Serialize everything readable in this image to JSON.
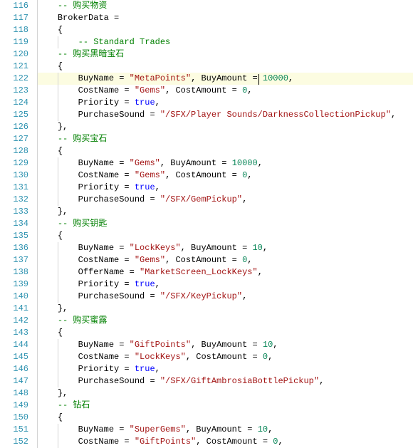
{
  "chart_data": null,
  "gutter": {
    "start": 116,
    "end": 152
  },
  "marked_line": 122,
  "lines": {
    "116": {
      "segments": [
        {
          "cls": "ind",
          "text": "    "
        },
        {
          "cls": "t-comment",
          "text": "-- 购买物资"
        }
      ]
    },
    "117": {
      "segments": [
        {
          "cls": "ind",
          "text": "    "
        },
        {
          "cls": "t-default",
          "text": "BrokerData ="
        }
      ]
    },
    "118": {
      "segments": [
        {
          "cls": "ind",
          "text": "    "
        },
        {
          "cls": "t-default",
          "text": "{"
        }
      ]
    },
    "119": {
      "segments": [
        {
          "cls": "ind",
          "text": "        "
        },
        {
          "cls": "t-comment",
          "text": "-- Standard Trades"
        }
      ]
    },
    "120": {
      "segments": [
        {
          "cls": "ind",
          "text": "    "
        },
        {
          "cls": "t-comment",
          "text": "-- 购买黑暗宝石"
        }
      ]
    },
    "121": {
      "segments": [
        {
          "cls": "ind",
          "text": "    "
        },
        {
          "cls": "t-default",
          "text": "{"
        }
      ]
    },
    "122": {
      "segments": [
        {
          "cls": "ind",
          "text": "        "
        },
        {
          "cls": "t-default",
          "text": "BuyName = "
        },
        {
          "cls": "t-string",
          "text": "\"MetaPoints\""
        },
        {
          "cls": "t-default",
          "text": ", BuyAmount ="
        },
        {
          "cls": "caret",
          "text": ""
        },
        {
          "cls": "t-default",
          "text": " "
        },
        {
          "cls": "t-number",
          "text": "10000"
        },
        {
          "cls": "t-default",
          "text": ","
        }
      ]
    },
    "123": {
      "segments": [
        {
          "cls": "ind",
          "text": "        "
        },
        {
          "cls": "t-default",
          "text": "CostName = "
        },
        {
          "cls": "t-string",
          "text": "\"Gems\""
        },
        {
          "cls": "t-default",
          "text": ", CostAmount = "
        },
        {
          "cls": "t-number",
          "text": "0"
        },
        {
          "cls": "t-default",
          "text": ","
        }
      ]
    },
    "124": {
      "segments": [
        {
          "cls": "ind",
          "text": "        "
        },
        {
          "cls": "t-default",
          "text": "Priority = "
        },
        {
          "cls": "t-keyword",
          "text": "true"
        },
        {
          "cls": "t-default",
          "text": ","
        }
      ]
    },
    "125": {
      "segments": [
        {
          "cls": "ind",
          "text": "        "
        },
        {
          "cls": "t-default",
          "text": "PurchaseSound = "
        },
        {
          "cls": "t-string",
          "text": "\"/SFX/Player Sounds/DarknessCollectionPickup\""
        },
        {
          "cls": "t-default",
          "text": ","
        }
      ]
    },
    "126": {
      "segments": [
        {
          "cls": "ind",
          "text": "    "
        },
        {
          "cls": "t-default",
          "text": "},"
        }
      ]
    },
    "127": {
      "segments": [
        {
          "cls": "ind",
          "text": "    "
        },
        {
          "cls": "t-comment",
          "text": "-- 购买宝石"
        }
      ]
    },
    "128": {
      "segments": [
        {
          "cls": "ind",
          "text": "    "
        },
        {
          "cls": "t-default",
          "text": "{"
        }
      ]
    },
    "129": {
      "segments": [
        {
          "cls": "ind",
          "text": "        "
        },
        {
          "cls": "t-default",
          "text": "BuyName = "
        },
        {
          "cls": "t-string",
          "text": "\"Gems\""
        },
        {
          "cls": "t-default",
          "text": ", BuyAmount = "
        },
        {
          "cls": "t-number",
          "text": "10000"
        },
        {
          "cls": "t-default",
          "text": ","
        }
      ]
    },
    "130": {
      "segments": [
        {
          "cls": "ind",
          "text": "        "
        },
        {
          "cls": "t-default",
          "text": "CostName = "
        },
        {
          "cls": "t-string",
          "text": "\"Gems\""
        },
        {
          "cls": "t-default",
          "text": ", CostAmount = "
        },
        {
          "cls": "t-number",
          "text": "0"
        },
        {
          "cls": "t-default",
          "text": ","
        }
      ]
    },
    "131": {
      "segments": [
        {
          "cls": "ind",
          "text": "        "
        },
        {
          "cls": "t-default",
          "text": "Priority = "
        },
        {
          "cls": "t-keyword",
          "text": "true"
        },
        {
          "cls": "t-default",
          "text": ","
        }
      ]
    },
    "132": {
      "segments": [
        {
          "cls": "ind",
          "text": "        "
        },
        {
          "cls": "t-default",
          "text": "PurchaseSound = "
        },
        {
          "cls": "t-string",
          "text": "\"/SFX/GemPickup\""
        },
        {
          "cls": "t-default",
          "text": ","
        }
      ]
    },
    "133": {
      "segments": [
        {
          "cls": "ind",
          "text": "    "
        },
        {
          "cls": "t-default",
          "text": "},"
        }
      ]
    },
    "134": {
      "segments": [
        {
          "cls": "ind",
          "text": "    "
        },
        {
          "cls": "t-comment",
          "text": "-- 购买钥匙"
        }
      ]
    },
    "135": {
      "segments": [
        {
          "cls": "ind",
          "text": "    "
        },
        {
          "cls": "t-default",
          "text": "{"
        }
      ]
    },
    "136": {
      "segments": [
        {
          "cls": "ind",
          "text": "        "
        },
        {
          "cls": "t-default",
          "text": "BuyName = "
        },
        {
          "cls": "t-string",
          "text": "\"LockKeys\""
        },
        {
          "cls": "t-default",
          "text": ", BuyAmount = "
        },
        {
          "cls": "t-number",
          "text": "10"
        },
        {
          "cls": "t-default",
          "text": ","
        }
      ]
    },
    "137": {
      "segments": [
        {
          "cls": "ind",
          "text": "        "
        },
        {
          "cls": "t-default",
          "text": "CostName = "
        },
        {
          "cls": "t-string",
          "text": "\"Gems\""
        },
        {
          "cls": "t-default",
          "text": ", CostAmount = "
        },
        {
          "cls": "t-number",
          "text": "0"
        },
        {
          "cls": "t-default",
          "text": ","
        }
      ]
    },
    "138": {
      "segments": [
        {
          "cls": "ind",
          "text": "        "
        },
        {
          "cls": "t-default",
          "text": "OfferName = "
        },
        {
          "cls": "t-string",
          "text": "\"MarketScreen_LockKeys\""
        },
        {
          "cls": "t-default",
          "text": ","
        }
      ]
    },
    "139": {
      "segments": [
        {
          "cls": "ind",
          "text": "        "
        },
        {
          "cls": "t-default",
          "text": "Priority = "
        },
        {
          "cls": "t-keyword",
          "text": "true"
        },
        {
          "cls": "t-default",
          "text": ","
        }
      ]
    },
    "140": {
      "segments": [
        {
          "cls": "ind",
          "text": "        "
        },
        {
          "cls": "t-default",
          "text": "PurchaseSound = "
        },
        {
          "cls": "t-string",
          "text": "\"/SFX/KeyPickup\""
        },
        {
          "cls": "t-default",
          "text": ","
        }
      ]
    },
    "141": {
      "segments": [
        {
          "cls": "ind",
          "text": "    "
        },
        {
          "cls": "t-default",
          "text": "},"
        }
      ]
    },
    "142": {
      "segments": [
        {
          "cls": "ind",
          "text": "    "
        },
        {
          "cls": "t-comment",
          "text": "-- 购买蜜露"
        }
      ]
    },
    "143": {
      "segments": [
        {
          "cls": "ind",
          "text": "    "
        },
        {
          "cls": "t-default",
          "text": "{"
        }
      ]
    },
    "144": {
      "segments": [
        {
          "cls": "ind",
          "text": "        "
        },
        {
          "cls": "t-default",
          "text": "BuyName = "
        },
        {
          "cls": "t-string",
          "text": "\"GiftPoints\""
        },
        {
          "cls": "t-default",
          "text": ", BuyAmount = "
        },
        {
          "cls": "t-number",
          "text": "10"
        },
        {
          "cls": "t-default",
          "text": ","
        }
      ]
    },
    "145": {
      "segments": [
        {
          "cls": "ind",
          "text": "        "
        },
        {
          "cls": "t-default",
          "text": "CostName = "
        },
        {
          "cls": "t-string",
          "text": "\"LockKeys\""
        },
        {
          "cls": "t-default",
          "text": ", CostAmount = "
        },
        {
          "cls": "t-number",
          "text": "0"
        },
        {
          "cls": "t-default",
          "text": ","
        }
      ]
    },
    "146": {
      "segments": [
        {
          "cls": "ind",
          "text": "        "
        },
        {
          "cls": "t-default",
          "text": "Priority = "
        },
        {
          "cls": "t-keyword",
          "text": "true"
        },
        {
          "cls": "t-default",
          "text": ","
        }
      ]
    },
    "147": {
      "segments": [
        {
          "cls": "ind",
          "text": "        "
        },
        {
          "cls": "t-default",
          "text": "PurchaseSound = "
        },
        {
          "cls": "t-string",
          "text": "\"/SFX/GiftAmbrosiaBottlePickup\""
        },
        {
          "cls": "t-default",
          "text": ","
        }
      ]
    },
    "148": {
      "segments": [
        {
          "cls": "ind",
          "text": "    "
        },
        {
          "cls": "t-default",
          "text": "},"
        }
      ]
    },
    "149": {
      "segments": [
        {
          "cls": "ind",
          "text": "    "
        },
        {
          "cls": "t-comment",
          "text": "-- 钻石"
        }
      ]
    },
    "150": {
      "segments": [
        {
          "cls": "ind",
          "text": "    "
        },
        {
          "cls": "t-default",
          "text": "{"
        }
      ]
    },
    "151": {
      "segments": [
        {
          "cls": "ind",
          "text": "        "
        },
        {
          "cls": "t-default",
          "text": "BuyName = "
        },
        {
          "cls": "t-string",
          "text": "\"SuperGems\""
        },
        {
          "cls": "t-default",
          "text": ", BuyAmount = "
        },
        {
          "cls": "t-number",
          "text": "10"
        },
        {
          "cls": "t-default",
          "text": ","
        }
      ]
    },
    "152": {
      "segments": [
        {
          "cls": "ind",
          "text": "        "
        },
        {
          "cls": "t-default",
          "text": "CostName = "
        },
        {
          "cls": "t-string",
          "text": "\"GiftPoints\""
        },
        {
          "cls": "t-default",
          "text": ", CostAmount = "
        },
        {
          "cls": "t-number",
          "text": "0"
        },
        {
          "cls": "t-default",
          "text": ","
        }
      ]
    }
  }
}
